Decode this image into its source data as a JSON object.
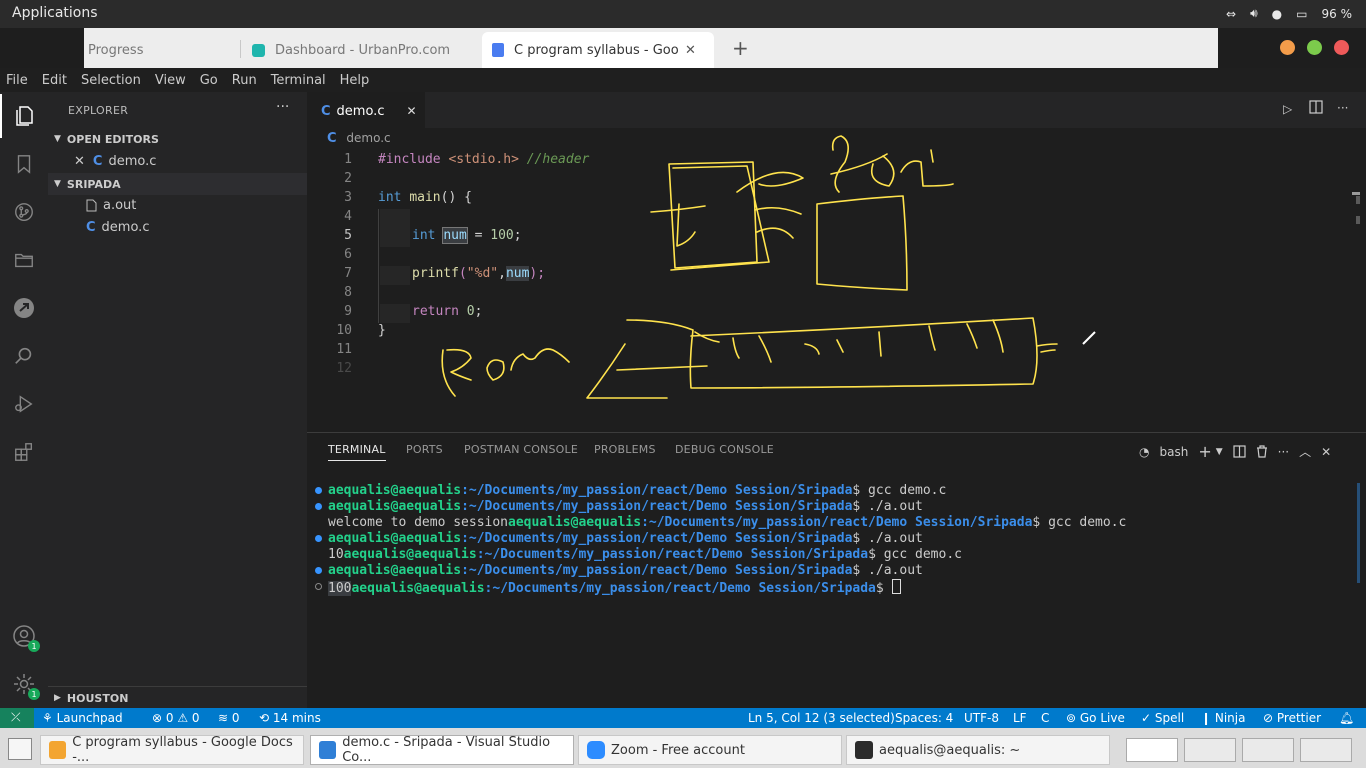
{
  "os_bar": {
    "app_label": "Applications",
    "battery": "96 %"
  },
  "browser_tabs": [
    {
      "label": "Progress"
    },
    {
      "label": "Dashboard - UrbanPro.com"
    },
    {
      "label": "C program syllabus - Googl"
    }
  ],
  "browser_new_tab": "+",
  "menu": [
    "File",
    "Edit",
    "Selection",
    "View",
    "Go",
    "Run",
    "Terminal",
    "Help"
  ],
  "sidebar": {
    "title": "EXPLORER",
    "open_editors_label": "OPEN EDITORS",
    "open_editors": [
      {
        "name": "demo.c"
      }
    ],
    "project_label": "SRIPADA",
    "files": [
      {
        "name": "a.out"
      },
      {
        "name": "demo.c"
      }
    ],
    "outline_label": "HOUSTON"
  },
  "editor": {
    "tab_label": "demo.c",
    "breadcrumb": "demo.c",
    "line_numbers": [
      "1",
      "2",
      "3",
      "4",
      "5",
      "6",
      "7",
      "8",
      "9",
      "10",
      "11",
      "12"
    ],
    "code": {
      "l1_include": "#include",
      "l1_header": "<stdio.h>",
      "l1_comment": "//header",
      "l3_int": "int",
      "l3_main": "main",
      "l3_rest": "() {",
      "l5_int": "int",
      "l5_var": "num",
      "l5_assign": " = ",
      "l5_value": "100",
      "l5_end": ";",
      "l7_printf": "printf",
      "l7_open": "(",
      "l7_fmt": "\"%d\"",
      "l7_comma": ",",
      "l7_var": "num",
      "l7_close": ");",
      "l9_return": "return",
      "l9_value": "0",
      "l9_end": ";",
      "l10_brace": "}"
    }
  },
  "panel": {
    "tabs": [
      "TERMINAL",
      "PORTS",
      "POSTMAN CONSOLE",
      "PROBLEMS",
      "DEBUG CONSOLE"
    ],
    "shell_label": "bash",
    "terminal_lines": [
      {
        "pre": "",
        "user": "aequalis@aequalis",
        "path": ":~/Documents/my_passion/react/Demo Session/Sripada",
        "cmd": "$ gcc demo.c"
      },
      {
        "pre": "",
        "user": "aequalis@aequalis",
        "path": ":~/Documents/my_passion/react/Demo Session/Sripada",
        "cmd": "$ ./a.out"
      },
      {
        "pre": "welcome to demo session",
        "user": "aequalis@aequalis",
        "path": ":~/Documents/my_passion/react/Demo Session/Sripada",
        "cmd": "$ gcc demo.c"
      },
      {
        "pre": "",
        "user": "aequalis@aequalis",
        "path": ":~/Documents/my_passion/react/Demo Session/Sripada",
        "cmd": "$ ./a.out"
      },
      {
        "pre": "10",
        "user": "aequalis@aequalis",
        "path": ":~/Documents/my_passion/react/Demo Session/Sripada",
        "cmd": "$ gcc demo.c"
      },
      {
        "pre": "",
        "user": "aequalis@aequalis",
        "path": ":~/Documents/my_passion/react/Demo Session/Sripada",
        "cmd": "$ ./a.out"
      },
      {
        "pre": "100",
        "user": "aequalis@aequalis",
        "path": ":~/Documents/my_passion/react/Demo Session/Sripada",
        "cmd": "$ "
      }
    ]
  },
  "status": {
    "launchpad": "Launchpad",
    "errors": "0",
    "warnings": "0",
    "ports": "0",
    "time": "14 mins",
    "cursor": "Ln 5, Col 12 (3 selected)",
    "spaces": "Spaces: 4",
    "encoding": "UTF-8",
    "eol": "LF",
    "language": "C",
    "golive": "Go Live",
    "spell": "Spell",
    "ninja": "Ninja",
    "prettier": "Prettier"
  },
  "taskbar": [
    {
      "label": "C program syllabus - Google Docs -..."
    },
    {
      "label": "demo.c - Sripada - Visual Studio Co..."
    },
    {
      "label": "Zoom - Free account"
    },
    {
      "label": "aequalis@aequalis: ~"
    }
  ],
  "badge_count": "1",
  "colors": {
    "accent": "#007acc",
    "annotation": "#ffe34d",
    "user": "#23d18b",
    "path": "#3b8eea"
  }
}
